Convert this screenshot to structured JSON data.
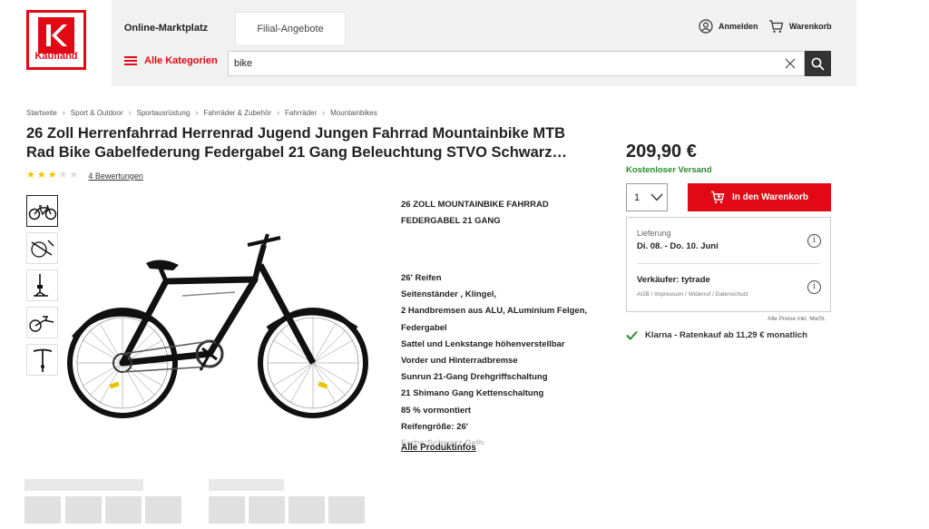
{
  "brand": {
    "name": "Kaufland",
    "accent": "#e10915"
  },
  "header": {
    "tabs": [
      {
        "label": "Online-Marktplatz",
        "active": true
      },
      {
        "label": "Filial-Angebote",
        "active": false
      }
    ],
    "login_label": "Anmelden",
    "cart_label": "Warenkorb",
    "categories_label": "Alle Kategorien",
    "search": {
      "value": "bike",
      "placeholder": ""
    }
  },
  "breadcrumb": [
    "Startseite",
    "Sport & Outdoor",
    "Sportausrüstung",
    "Fahrräder & Zubehör",
    "Fahrräder",
    "Mountainbikes"
  ],
  "product": {
    "title": "26 Zoll Herrenfahrrad Herrenrad Jugend Jungen Fahrrad Mountainbike MTB Rad Bike Gabelfederung Federgabel 21 Gang Beleuchtung STVO Schwarz…",
    "rating": 3,
    "rating_max": 5,
    "reviews_label": "4 Bewertungen",
    "thumbnail_count": 5,
    "description": {
      "heading_line1": "26 ZOLL MOUNTAINBIKE FAHRRAD",
      "heading_line2": "FEDERGABEL  21 GANG",
      "features": [
        "26' Reifen",
        "Seitenständer , Klingel,",
        "2 Handbremsen aus ALU, ALuminium Felgen,",
        "Federgabel",
        "Sattel und Lenkstange höhenverstellbar",
        "Vorder und Hinterradbremse",
        "Sunrun 21-Gang Drehgriffschaltung",
        "21 Shimano Gang Kettenschaltung",
        "85 % vormontiert",
        "Reifengröße: 26'"
      ],
      "faded_line": "Farbe:Schwarz Gelb",
      "all_info_label": "Alle Produktinfos"
    }
  },
  "buybox": {
    "price": "209,90 €",
    "shipping": "Kostenloser Versand",
    "quantity": "1",
    "add_to_cart_label": "In den Warenkorb",
    "delivery_label": "Lieferung",
    "delivery_date": "Di. 08. - Do. 10. Juni",
    "seller": "Verkäufer: tytrade",
    "seller_links": "AGB / Impressum / Widerruf / Datenschutz",
    "vat_note": "Alle Preise inkl. MwSt.",
    "klarna": "Klarna - Ratenkauf ab 11,29 € monatlich",
    "success_color": "#2a8a2a"
  }
}
